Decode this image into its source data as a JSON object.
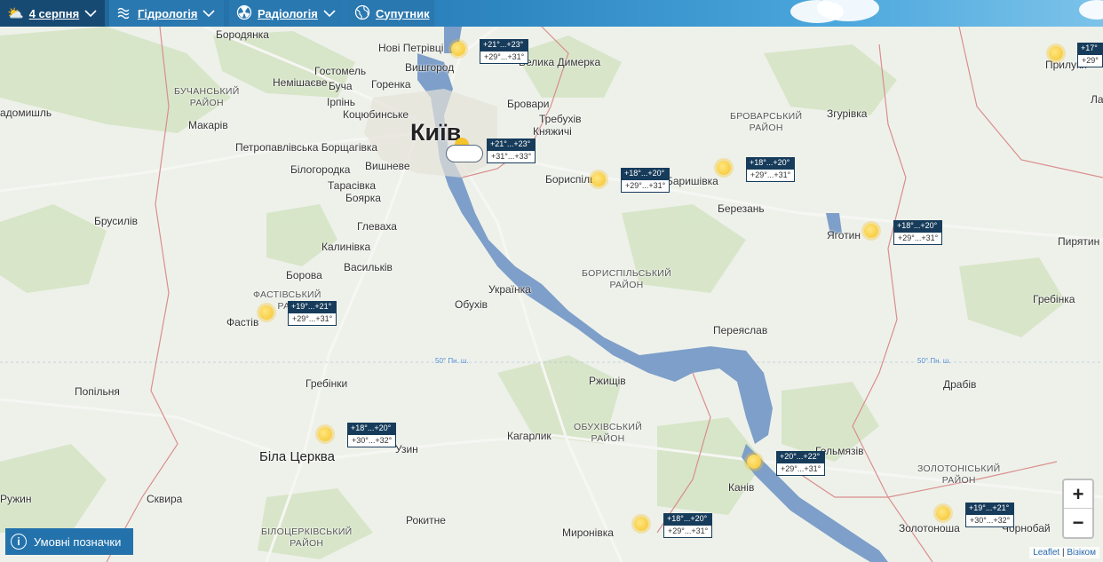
{
  "toolbar": {
    "date_label": "4 серпня",
    "hydrology_label": "Гідрологія",
    "radiology_label": "Радіологія",
    "satellite_label": "Супутник"
  },
  "map": {
    "cities": {
      "kyiv": "Київ",
      "bila_tserkva": "Біла Церква",
      "brovary": "Бровари",
      "boryspil": "Бориспіль",
      "fastiv": "Фастів",
      "pryluky": "Прилуки",
      "kaniv": "Канів",
      "pereiaslav": "Переяслав",
      "obukhiv": "Обухів",
      "vyshhorod": "Вишгород",
      "irpin": "Ірпінь",
      "bucha": "Буча",
      "yahotyn": "Яготин",
      "zolotonosha": "Золотоноша",
      "myronivka": "Миронівка",
      "kaharlyk": "Кагарлик",
      "rzhyshchiv": "Ржищів",
      "uzyn": "Узин",
      "baryshivka": "Баришівка",
      "berezan": "Березань",
      "pyriatyn": "Пирятин",
      "hrebinka": "Гребінка",
      "drabiv": "Драбів",
      "helmiaziv": "Гельмязів",
      "skvyra": "Сквира",
      "rokytne": "Рокитне",
      "ruzhyn": "Ружин",
      "radomyshl": "адомишль",
      "borodianka": "Бородянка",
      "nove_petrivtsi": "Нові Петрівці",
      "velyka_dymerka": "Велика Димерка",
      "hostomel": "Гостомель",
      "nemishaieve": "Немішаєве",
      "horenka": "Горенка",
      "kotsiubynske": "Коцюбинське",
      "makariv": "Макарів",
      "petropavlivska": "Петропавлівська Борщагівка",
      "bilohorodka": "Білогородка",
      "vyshneve": "Вишневе",
      "tarasivka": "Тарасівка",
      "boiarka": "Боярка",
      "hlevakha": "Глеваха",
      "kalynivka": "Калинівка",
      "vasylkiv": "Васильків",
      "borova": "Борова",
      "brusyliv": "Брусилів",
      "trebukhiv": "Требухів",
      "kniazhychi": "Княжичі",
      "zghurivka": "Згурівка",
      "ukrainka": "Українка",
      "hrebinky": "Гребінки",
      "popilnia": "Попільня",
      "chornobai": "Чорнобай",
      "lazh": "Ла"
    },
    "districts": {
      "buchanskyi": [
        "БУЧАНСЬКИЙ",
        "РАЙОН"
      ],
      "brovarskyi": [
        "БРОВАРСЬКИЙ",
        "РАЙОН"
      ],
      "boryspilskyi": [
        "БОРИСПІЛЬСЬКИЙ",
        "РАЙОН"
      ],
      "fastivskyi": [
        "ФАСТІВСЬКИЙ",
        "РАЙ"
      ],
      "obukhivskyi": [
        "ОБУХІВСЬКИЙ",
        "РАЙОН"
      ],
      "bilotserkivskyi": [
        "БІЛОЦЕРКІВСЬКИЙ",
        "РАЙОН"
      ],
      "zolotoniskyi": [
        "ЗОЛОТОНІСЬКИЙ",
        "РАЙОН"
      ]
    },
    "latitude_label": "50° Пн. ш."
  },
  "forecasts": [
    {
      "id": "vyshhorod",
      "night": "+21°...+23°",
      "day": "+29°...+31°",
      "icon": "sun-icon"
    },
    {
      "id": "kyiv",
      "night": "+21°...+23°",
      "day": "+31°...+33°",
      "icon": "cloud-sun-icon"
    },
    {
      "id": "boryspil",
      "night": "+18°...+20°",
      "day": "+29°...+31°",
      "icon": "sun-icon"
    },
    {
      "id": "baryshivka",
      "night": "+18°...+20°",
      "day": "+29°...+31°",
      "icon": "sun-icon"
    },
    {
      "id": "yahotyn",
      "night": "+18°...+20°",
      "day": "+29°...+31°",
      "icon": "sun-icon"
    },
    {
      "id": "pryluky",
      "night": "+17°",
      "day": "+29°",
      "icon": "sun-icon"
    },
    {
      "id": "fastiv",
      "night": "+19°...+21°",
      "day": "+29°...+31°",
      "icon": "sun-icon"
    },
    {
      "id": "bila_tserkva",
      "night": "+18°...+20°",
      "day": "+30°...+32°",
      "icon": "sun-icon"
    },
    {
      "id": "kaniv",
      "night": "+20°...+22°",
      "day": "+29°...+31°",
      "icon": "sun-icon"
    },
    {
      "id": "myronivka",
      "night": "+18°...+20°",
      "day": "+29°...+31°",
      "icon": "sun-icon"
    },
    {
      "id": "zolotonosha",
      "night": "+19°...+21°",
      "day": "+30°...+32°",
      "icon": "sun-icon"
    }
  ],
  "zoom": {
    "in": "+",
    "out": "−"
  },
  "legend_button": "Умовні позначки",
  "attribution": {
    "leaflet": "Leaflet",
    "separator": " | ",
    "visicom": "Візіком"
  },
  "colors": {
    "water": "#7d9fc9",
    "topbar": "#2a78b0",
    "badge_dark": "#173c5b",
    "border": "#d98e8e"
  }
}
